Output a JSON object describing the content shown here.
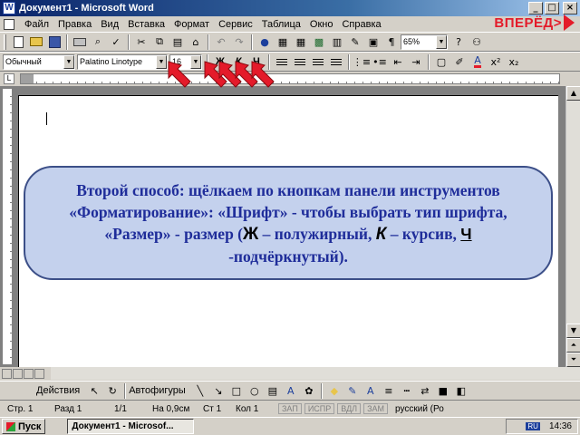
{
  "window": {
    "title": "Документ1 - Microsoft Word"
  },
  "forward": {
    "label": "ВПЕРЁД>"
  },
  "menu": [
    "Файл",
    "Правка",
    "Вид",
    "Вставка",
    "Формат",
    "Сервис",
    "Таблица",
    "Окно",
    "Справка"
  ],
  "toolbar": {
    "zoom": "65%"
  },
  "format": {
    "style": "Обычный",
    "font": "Palatino Linotype",
    "size": "16",
    "bold_label": "Ж",
    "italic_label": "К",
    "underline_label": "Ч"
  },
  "callout": {
    "part1": "Второй способ: щёлкаем по кнопкам панели инструментов «Форматирование»: «Шрифт» - чтобы выбрать тип шрифта, «Размер» - размер (",
    "bold_letter": "Ж",
    "part2": " – полужирный, ",
    "italic_letter": "К",
    "part3": " – курсив, ",
    "underline_letter": "Ч",
    "part4": " -подчёркнутый)."
  },
  "drawing": {
    "actions": "Действия",
    "autoshapes": "Автофигуры"
  },
  "status": {
    "page": "Стр. 1",
    "section": "Разд 1",
    "pages": "1/1",
    "at": "На 0,9см",
    "line": "Ст 1",
    "col": "Кол 1",
    "rec": "ЗАП",
    "trk": "ИСПР",
    "ext": "ВДЛ",
    "ovr": "ЗАМ",
    "language": "русский (Ро"
  },
  "taskbar": {
    "start": "Пуск",
    "task": "Документ1 - Microsof...",
    "lang": "RU",
    "clock": "14:36"
  },
  "colors": {
    "callout_text": "#1f2d9a",
    "callout_bg": "#c4d1ed",
    "arrow": "#e41b2a"
  }
}
